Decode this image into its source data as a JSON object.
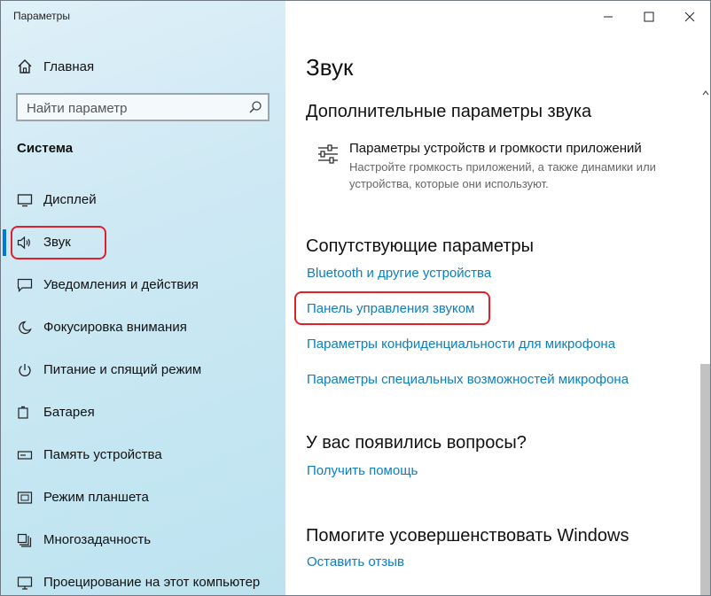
{
  "app_title": "Параметры",
  "sidebar": {
    "home_label": "Главная",
    "search_placeholder": "Найти параметр",
    "section_title": "Система",
    "items": [
      {
        "label": "Дисплей",
        "icon": "display-icon"
      },
      {
        "label": "Звук",
        "icon": "speaker-icon",
        "selected": true
      },
      {
        "label": "Уведомления и действия",
        "icon": "notifications-icon"
      },
      {
        "label": "Фокусировка внимания",
        "icon": "moon-icon"
      },
      {
        "label": "Питание и спящий режим",
        "icon": "power-icon"
      },
      {
        "label": "Батарея",
        "icon": "battery-icon"
      },
      {
        "label": "Память устройства",
        "icon": "storage-icon"
      },
      {
        "label": "Режим планшета",
        "icon": "tablet-mode-icon"
      },
      {
        "label": "Многозадачность",
        "icon": "multitasking-icon"
      },
      {
        "label": "Проецирование на этот компьютер",
        "icon": "projecting-icon"
      }
    ]
  },
  "content": {
    "page_title": "Звук",
    "advanced_heading": "Дополнительные параметры звука",
    "app_volume_title": "Параметры устройств и громкости приложений",
    "app_volume_desc": "Настройте громкость приложений, а также динамики или устройства, которые они используют.",
    "related_heading": "Сопутствующие параметры",
    "related_links": [
      "Bluetooth и другие устройства",
      "Панель управления звуком",
      "Параметры конфиденциальности для микрофона",
      "Параметры специальных возможностей микрофона"
    ],
    "questions_heading": "У вас появились вопросы?",
    "help_link": "Получить помощь",
    "improve_heading": "Помогите усовершенствовать Windows",
    "feedback_link": "Оставить отзыв"
  },
  "colors": {
    "accent": "#0078d7",
    "link": "#0a7fc2",
    "highlight": "#e0202a"
  }
}
